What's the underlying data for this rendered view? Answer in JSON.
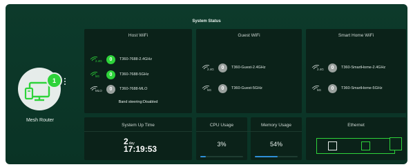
{
  "header": {
    "title": "System Status"
  },
  "device": {
    "name": "Mesh Router",
    "client_count": "1"
  },
  "host_wifi": {
    "title": "Host WiFi",
    "networks": [
      {
        "band": "2.4G",
        "count": "0",
        "ssid": "T360-7688-2.4GHz",
        "active": true
      },
      {
        "band": "5G",
        "count": "0",
        "ssid": "T360-7688-5GHz",
        "active": true
      },
      {
        "band": "MLO",
        "count": "0",
        "ssid": "T360-7688-MLO",
        "active": false
      }
    ],
    "band_steering": "Band steering:Disabled"
  },
  "guest_wifi": {
    "title": "Guest WiFi",
    "networks": [
      {
        "band": "2.4G",
        "count": "0",
        "ssid": "T360-Guest-2.4GHz",
        "active": false
      },
      {
        "band": "5G",
        "count": "0",
        "ssid": "T360-Guest-5GHz",
        "active": false
      }
    ]
  },
  "smart_home_wifi": {
    "title": "Smart Home WiFi",
    "networks": [
      {
        "band": "2.4G",
        "count": "0",
        "ssid": "T360-SmartHome-2.4GHz",
        "active": false
      },
      {
        "band": "5G",
        "count": "0",
        "ssid": "T360-SmartHome-5GHz",
        "active": false
      }
    ]
  },
  "uptime": {
    "title": "System Up Time",
    "days": "2",
    "days_unit": "day",
    "time": "17:19:53"
  },
  "cpu": {
    "title": "CPU Usage",
    "value": "3%",
    "fraction": 0.03
  },
  "memory": {
    "title": "Memory Usage",
    "value": "54%",
    "fraction": 0.54
  },
  "ethernet": {
    "title": "Ethernet"
  },
  "colors": {
    "accent": "#2ed33a",
    "bar_blue": "#2f8fd8",
    "inactive": "#9aa19e"
  }
}
